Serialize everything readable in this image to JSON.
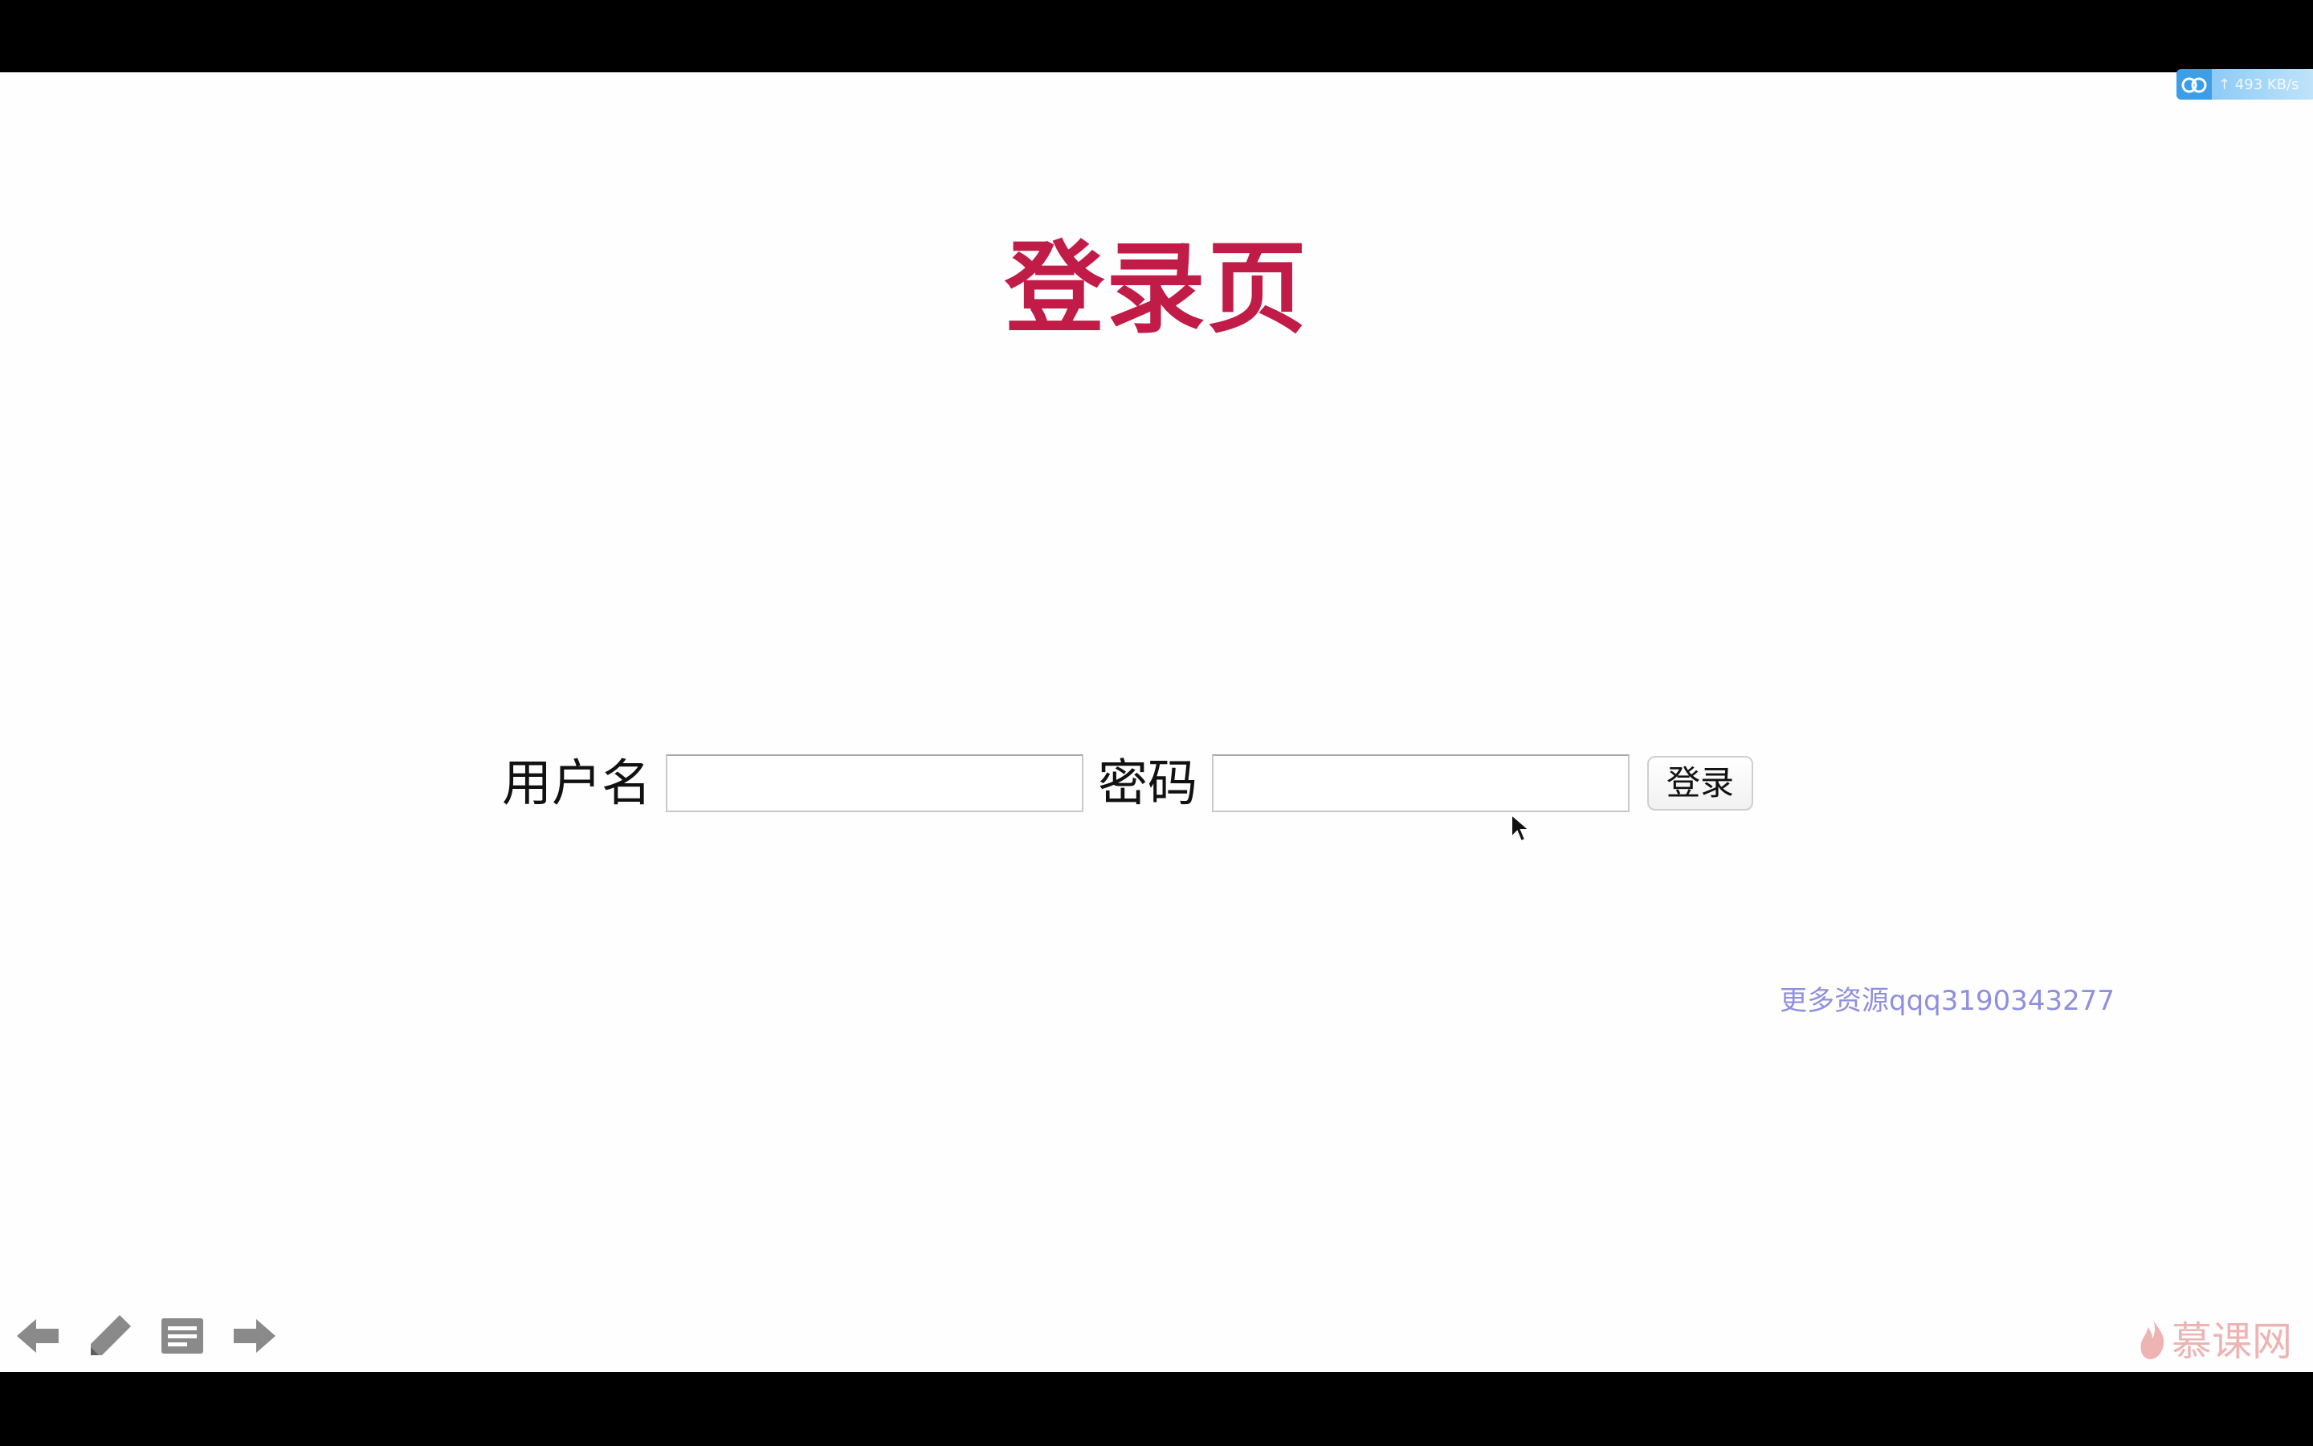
{
  "page": {
    "title": "登录页"
  },
  "form": {
    "username_label": "用户名",
    "username_value": "",
    "password_label": "密码",
    "password_value": "",
    "submit_label": "登录"
  },
  "watermark": {
    "text": "更多资源qqq3190343277"
  },
  "cloud_widget": {
    "speed": "↑ 493 KB/s",
    "icon": "cloud-icon"
  },
  "player_controls": [
    {
      "name": "previous",
      "icon": "arrow-left-icon"
    },
    {
      "name": "pen",
      "icon": "pencil-icon"
    },
    {
      "name": "notes",
      "icon": "notes-icon"
    },
    {
      "name": "next",
      "icon": "arrow-right-icon"
    }
  ],
  "brand": {
    "name": "慕课网",
    "icon": "flame-icon"
  },
  "colors": {
    "title": "#c01c47",
    "watermark": "#8f8fdf",
    "control_icons": "#8a8a8a",
    "brand": "#eeb4b4",
    "letterbox": "#000000"
  }
}
